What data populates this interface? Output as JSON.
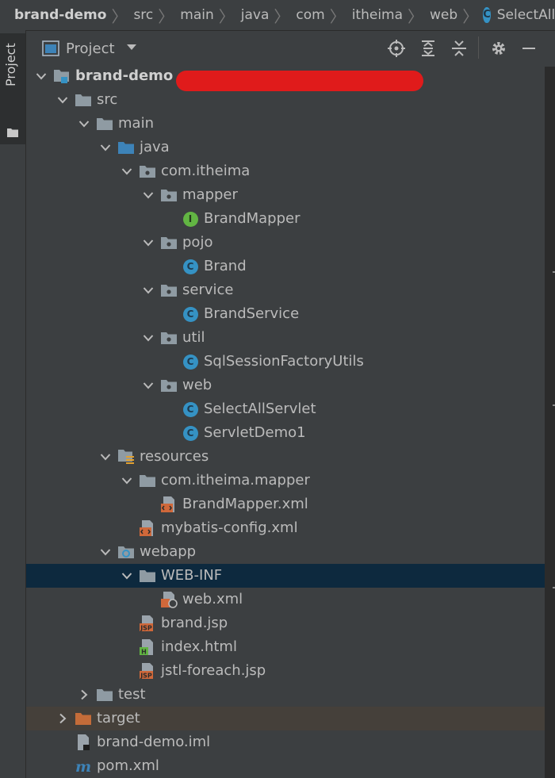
{
  "breadcrumb": {
    "items": [
      "brand-demo",
      "src",
      "main",
      "java",
      "com",
      "itheima",
      "web"
    ],
    "current_icon_letter": "C",
    "current": "SelectAllServlet"
  },
  "tool_window": {
    "stripe_label": "Project"
  },
  "panel": {
    "title": "Project",
    "actions": [
      "locate-icon",
      "expand-all-icon",
      "collapse-all-icon",
      "gear-icon",
      "minimize-icon"
    ]
  },
  "tree": [
    {
      "label": "brand-demo",
      "icon": "module-icon",
      "expanded": true,
      "depth": 0,
      "bold": true
    },
    {
      "label": "src",
      "icon": "folder-icon",
      "expanded": true,
      "depth": 1
    },
    {
      "label": "main",
      "icon": "folder-icon",
      "expanded": true,
      "depth": 2
    },
    {
      "label": "java",
      "icon": "source-folder-icon",
      "expanded": true,
      "depth": 3
    },
    {
      "label": "com.itheima",
      "icon": "package-icon",
      "expanded": true,
      "depth": 4
    },
    {
      "label": "mapper",
      "icon": "package-icon",
      "expanded": true,
      "depth": 5
    },
    {
      "label": "BrandMapper",
      "icon": "interface-icon",
      "icon_letter": "I",
      "depth": 6
    },
    {
      "label": "pojo",
      "icon": "package-icon",
      "expanded": true,
      "depth": 5
    },
    {
      "label": "Brand",
      "icon": "class-icon",
      "icon_letter": "C",
      "depth": 6
    },
    {
      "label": "service",
      "icon": "package-icon",
      "expanded": true,
      "depth": 5
    },
    {
      "label": "BrandService",
      "icon": "class-icon",
      "icon_letter": "C",
      "depth": 6
    },
    {
      "label": "util",
      "icon": "package-icon",
      "expanded": true,
      "depth": 5
    },
    {
      "label": "SqlSessionFactoryUtils",
      "icon": "class-icon",
      "icon_letter": "C",
      "depth": 6
    },
    {
      "label": "web",
      "icon": "package-icon",
      "expanded": true,
      "depth": 5
    },
    {
      "label": "SelectAllServlet",
      "icon": "class-icon",
      "icon_letter": "C",
      "depth": 6
    },
    {
      "label": "ServletDemo1",
      "icon": "class-icon",
      "icon_letter": "C",
      "depth": 6
    },
    {
      "label": "resources",
      "icon": "resources-folder-icon",
      "expanded": true,
      "depth": 3
    },
    {
      "label": "com.itheima.mapper",
      "icon": "folder-icon",
      "expanded": true,
      "depth": 4
    },
    {
      "label": "BrandMapper.xml",
      "icon": "xml-file-icon",
      "depth": 5
    },
    {
      "label": "mybatis-config.xml",
      "icon": "xml-file-icon",
      "depth": 4
    },
    {
      "label": "webapp",
      "icon": "web-folder-icon",
      "expanded": true,
      "depth": 3
    },
    {
      "label": "WEB-INF",
      "icon": "folder-icon",
      "expanded": true,
      "depth": 4,
      "selected": true
    },
    {
      "label": "web.xml",
      "icon": "web-xml-file-icon",
      "depth": 5
    },
    {
      "label": "brand.jsp",
      "icon": "jsp-file-icon",
      "icon_letter": "JSP",
      "depth": 4
    },
    {
      "label": "index.html",
      "icon": "html-file-icon",
      "icon_letter": "H",
      "depth": 4
    },
    {
      "label": "jstl-foreach.jsp",
      "icon": "jsp-file-icon",
      "icon_letter": "JSP",
      "depth": 4
    },
    {
      "label": "test",
      "icon": "folder-icon",
      "expanded": false,
      "depth": 2
    },
    {
      "label": "target",
      "icon": "excluded-folder-icon",
      "expanded": false,
      "depth": 1,
      "excluded": true
    },
    {
      "label": "brand-demo.iml",
      "icon": "iml-file-icon",
      "depth": 1
    },
    {
      "label": "pom.xml",
      "icon": "maven-icon",
      "icon_letter": "m",
      "depth": 1
    }
  ],
  "colors": {
    "background": "#3c3f41",
    "selection": "#0d293e",
    "excluded_row": "#45403a",
    "class_icon": "#3592c4",
    "interface_icon": "#62b543",
    "xml_icon": "#d0683a",
    "folder": "#8f9ba3",
    "source_folder": "#3d83b8",
    "excluded_folder": "#c46c39",
    "redaction": "#e01b1b"
  }
}
